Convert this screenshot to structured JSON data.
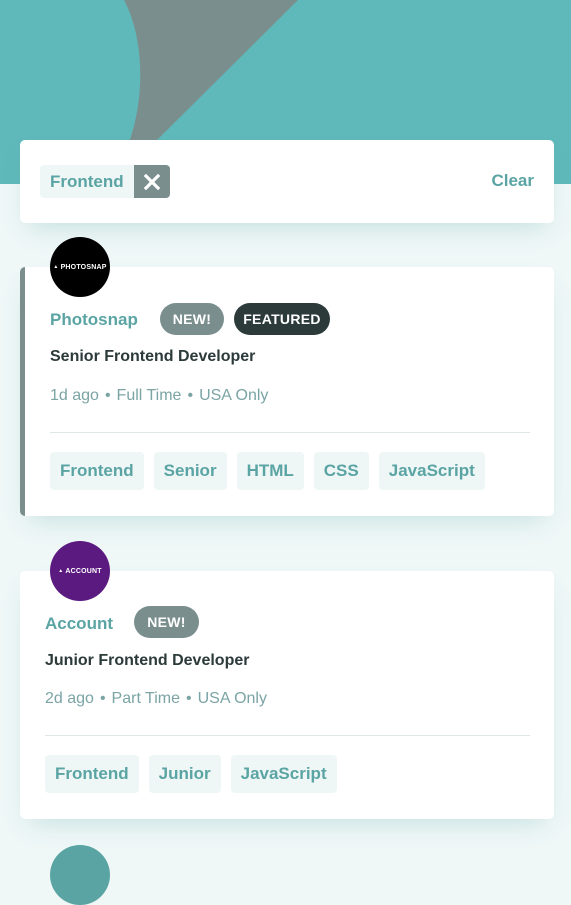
{
  "colors": {
    "header_bg": "#5FB9BA",
    "page_bg": "#EFF7F7",
    "accent": "#5BA4A4",
    "badge_new": "#7B8E8E",
    "badge_featured": "#2C3A3A"
  },
  "filter_bar": {
    "filters": [
      {
        "label": "Frontend",
        "remove_icon": "close-icon"
      }
    ],
    "clear_label": "Clear"
  },
  "jobs": [
    {
      "logo_text": "PHOTOSNAP",
      "logo_color": "#000000",
      "company": "Photosnap",
      "new_label": "NEW!",
      "featured_label": "FEATURED",
      "position": "Senior Frontend Developer",
      "posted": "1d ago",
      "contract": "Full Time",
      "location": "USA Only",
      "separator": "•",
      "tags": [
        "Frontend",
        "Senior",
        "HTML",
        "CSS",
        "JavaScript"
      ]
    },
    {
      "logo_text": "ACCOUNT",
      "logo_color": "#5B1A7F",
      "company": "Account",
      "new_label": "NEW!",
      "position": "Junior Frontend Developer",
      "posted": "2d ago",
      "contract": "Part Time",
      "location": "USA Only",
      "separator": "•",
      "tags": [
        "Frontend",
        "Junior",
        "JavaScript"
      ]
    }
  ]
}
